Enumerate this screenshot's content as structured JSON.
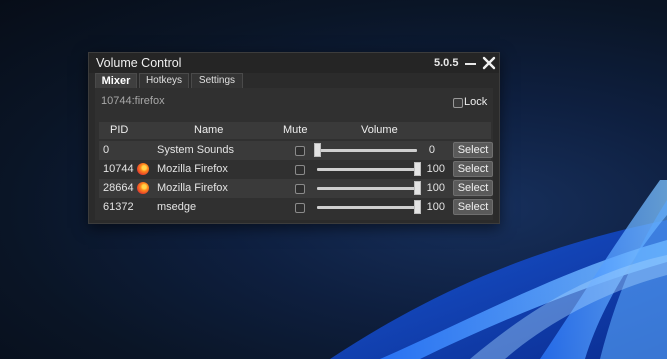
{
  "window": {
    "title": "Volume Control",
    "version": "5.0.5"
  },
  "tabs": [
    {
      "label": "Mixer",
      "active": true
    },
    {
      "label": "Hotkeys",
      "active": false
    },
    {
      "label": "Settings",
      "active": false
    }
  ],
  "filter": {
    "value": "10744:firefox"
  },
  "lock": {
    "label": "Lock",
    "checked": false
  },
  "columns": {
    "pid": "PID",
    "name": "Name",
    "mute": "Mute",
    "volume": "Volume"
  },
  "rows": [
    {
      "pid": "0",
      "name": "System Sounds",
      "icon": "none",
      "muted": false,
      "volume": 0,
      "volume_label": "0",
      "button": "Select"
    },
    {
      "pid": "10744",
      "name": "Mozilla Firefox",
      "icon": "firefox-icon",
      "muted": false,
      "volume": 100,
      "volume_label": "100",
      "button": "Select"
    },
    {
      "pid": "28664",
      "name": "Mozilla Firefox",
      "icon": "firefox-icon",
      "muted": false,
      "volume": 100,
      "volume_label": "100",
      "button": "Select"
    },
    {
      "pid": "61372",
      "name": "msedge",
      "icon": "none",
      "muted": false,
      "volume": 100,
      "volume_label": "100",
      "button": "Select"
    }
  ],
  "colors": {
    "window_bg": "#2b2b2b",
    "row_alt": "#3a3a3a",
    "button": "#5a5a5a",
    "wallpaper_accent": "#2a6ff0"
  }
}
